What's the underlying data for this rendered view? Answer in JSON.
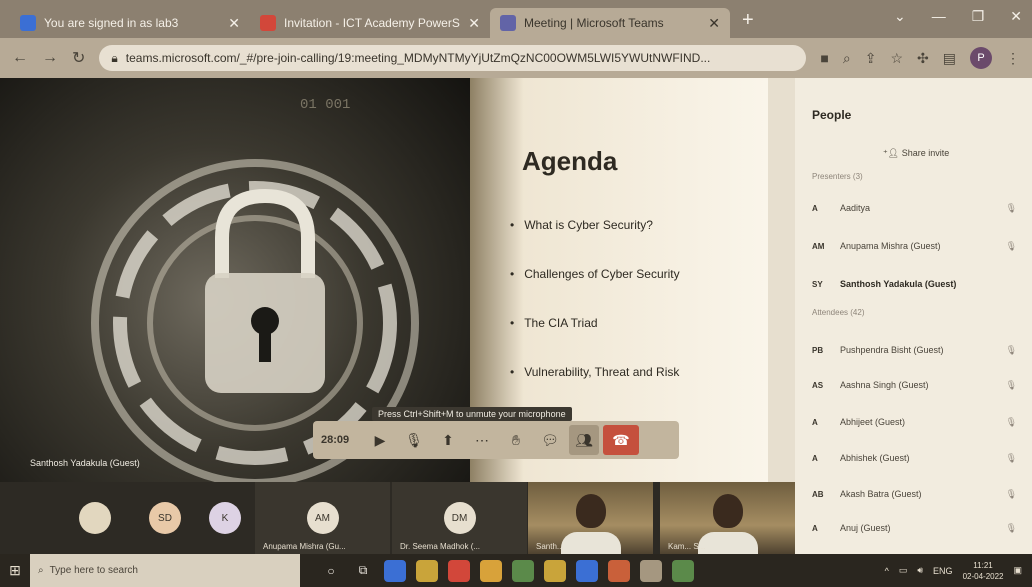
{
  "browser": {
    "tabs": [
      {
        "title": "You are signed in as lab3",
        "active": false,
        "icon_color": "#3b6fd4"
      },
      {
        "title": "Invitation - ICT Academy PowerS",
        "active": false,
        "icon_color": "#d2473a"
      },
      {
        "title": "Meeting | Microsoft Teams",
        "active": true,
        "icon_color": "#6264a7"
      }
    ],
    "url": "teams.microsoft.com/_#/pre-join-calling/19:meeting_MDMyNTMyYjUtZmQzNC00OWM5LWI5YWUtNWFIND...",
    "profile_initial": "P"
  },
  "slide": {
    "title": "Agenda",
    "bullets": [
      "What is Cyber Security?",
      "Challenges of Cyber Security",
      "The CIA Triad",
      "Vulnerability, Threat and Risk"
    ]
  },
  "presenter_name": "Santhosh Yadakula (Guest)",
  "call": {
    "timer": "28:09",
    "hint": "Press Ctrl+Shift+M to unmute your microphone"
  },
  "strip": {
    "tiles": [
      {
        "initials": "",
        "name": ""
      },
      {
        "initials": "SD",
        "name": ""
      },
      {
        "initials": "K",
        "name": ""
      },
      {
        "initials": "AM",
        "name": "Anupama Mishra (Gu..."
      },
      {
        "initials": "DM",
        "name": "Dr. Seema Madhok (..."
      },
      {
        "initials": "",
        "name": "Santh..."
      },
      {
        "initials": "",
        "name": "Kam... S..."
      }
    ]
  },
  "people": {
    "title": "People",
    "share_invite": "Share invite",
    "presenters_label": "Presenters (3)",
    "attendees_label": "Attendees (42)",
    "presenters": [
      {
        "initials": "A",
        "name": "Aaditya"
      },
      {
        "initials": "AM",
        "name": "Anupama Mishra (Guest)"
      },
      {
        "initials": "SY",
        "name": "Santhosh Yadakula (Guest)",
        "bold": true
      }
    ],
    "attendees": [
      {
        "initials": "PB",
        "name": "Pushpendra Bisht (Guest)"
      },
      {
        "initials": "AS",
        "name": "Aashna Singh (Guest)"
      },
      {
        "initials": "A",
        "name": "Abhijeet (Guest)"
      },
      {
        "initials": "A",
        "name": "Abhishek (Guest)"
      },
      {
        "initials": "AB",
        "name": "Akash Batra (Guest)"
      },
      {
        "initials": "A",
        "name": "Anuj (Guest)"
      }
    ]
  },
  "taskbar": {
    "search_placeholder": "Type here to search",
    "lang": "ENG",
    "time": "11:21",
    "date": "02-04-2022"
  }
}
